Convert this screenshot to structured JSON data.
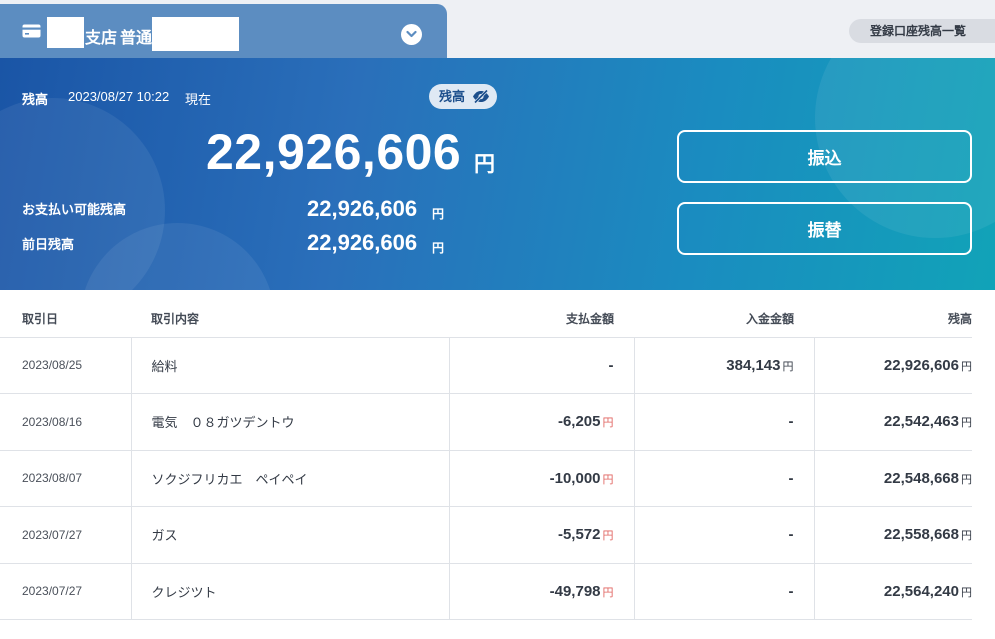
{
  "header": {
    "account_branch": "支店",
    "account_type": "普通",
    "account_list_button": "登録口座残高一覧"
  },
  "balance": {
    "label": "残高",
    "datetime": "2023/08/27 10:22",
    "as_of": "現在",
    "toggle_label": "残高",
    "amount": "22,926,606",
    "currency": "円",
    "available_label": "お支払い可能残高",
    "available_amount": "22,926,606",
    "previous_label": "前日残高",
    "previous_amount": "22,926,606"
  },
  "actions": {
    "transfer": "振込",
    "move": "振替"
  },
  "table": {
    "headers": {
      "date": "取引日",
      "description": "取引内容",
      "withdrawal": "支払金額",
      "deposit": "入金金額",
      "balance": "残高"
    },
    "yen": "円",
    "rows": [
      {
        "date": "2023/08/25",
        "description": "給料",
        "withdrawal": "-",
        "deposit": "384,143",
        "balance": "22,926,606"
      },
      {
        "date": "2023/08/16",
        "description": "電気　０８ガツデントウ",
        "withdrawal": "-6,205",
        "deposit": "-",
        "balance": "22,542,463"
      },
      {
        "date": "2023/08/07",
        "description": "ソクジフリカエ　ペイペイ",
        "withdrawal": "-10,000",
        "deposit": "-",
        "balance": "22,548,668"
      },
      {
        "date": "2023/07/27",
        "description": "ガス",
        "withdrawal": "-5,572",
        "deposit": "-",
        "balance": "22,558,668"
      },
      {
        "date": "2023/07/27",
        "description": "クレジツト",
        "withdrawal": "-49,798",
        "deposit": "-",
        "balance": "22,564,240"
      }
    ]
  },
  "colors": {
    "negative": "#e0625e",
    "tab": "#5c8dc1",
    "panel_start": "#1a55a6",
    "panel_end": "#11a3b8"
  }
}
